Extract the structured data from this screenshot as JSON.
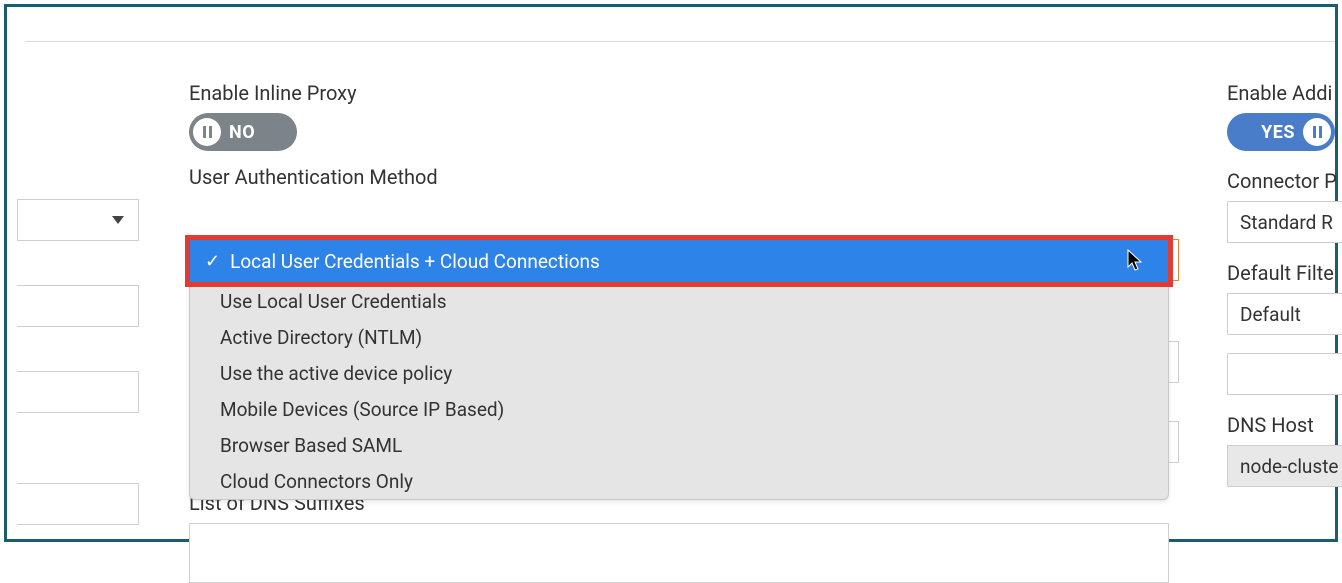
{
  "main": {
    "enable_inline_proxy_label": "Enable Inline Proxy",
    "toggle_no": "NO",
    "auth_method_label": "User Authentication Method",
    "dropdown": {
      "selected": "Local User Credentials + Cloud Connections",
      "options": [
        "Use Local User Credentials",
        "Active Directory (NTLM)",
        "Use the active device policy",
        "Mobile Devices (Source IP Based)",
        "Browser Based SAML",
        "Cloud Connectors Only"
      ]
    },
    "dns_suffixes_label": "List of DNS Suffixes"
  },
  "right": {
    "enable_addi_label": "Enable Addi",
    "toggle_yes": "YES",
    "connector_label": "Connector P",
    "connector_value": "Standard R",
    "default_filter_label": "Default Filte",
    "default_filter_value": "Default",
    "dns_host_label": "DNS Host",
    "dns_host_value": "node-cluste"
  }
}
